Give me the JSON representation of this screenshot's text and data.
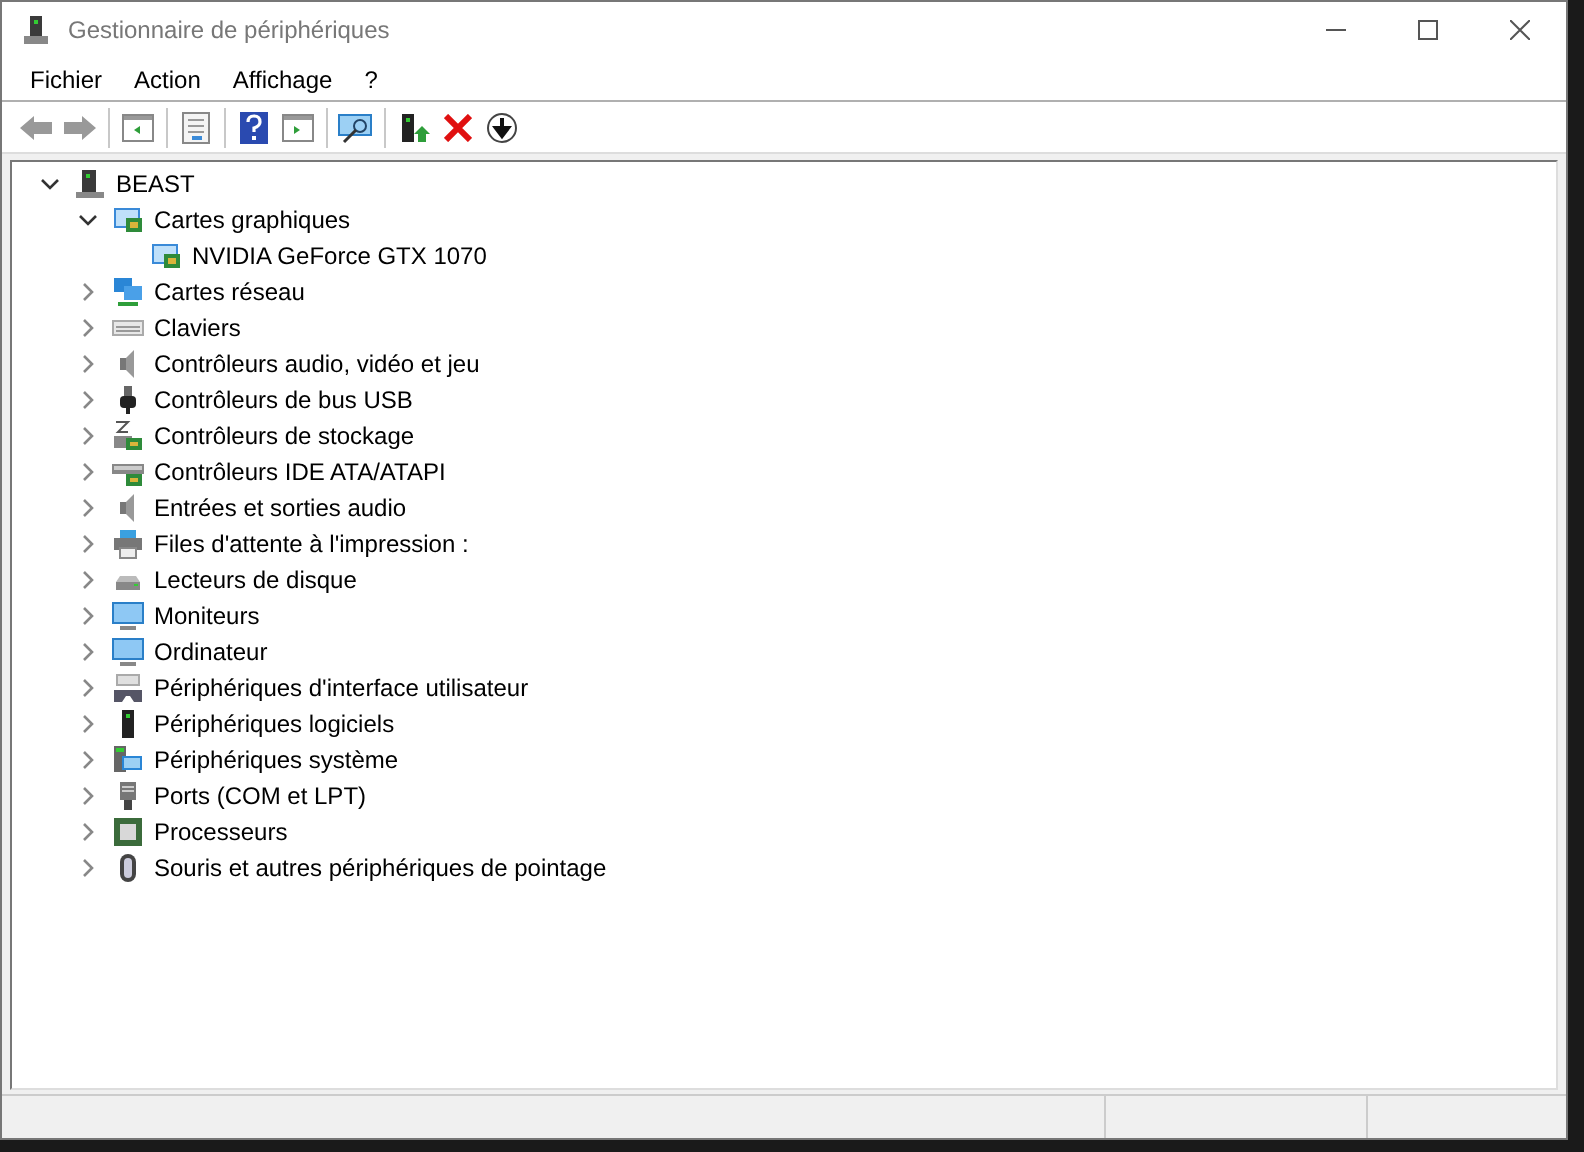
{
  "window": {
    "title": "Gestionnaire de périphériques"
  },
  "menu": [
    "Fichier",
    "Action",
    "Affichage",
    "?"
  ],
  "tree": [
    {
      "label": "BEAST",
      "kind": "computer",
      "expanded": true,
      "children": [
        {
          "label": "Cartes graphiques",
          "kind": "display",
          "expanded": true,
          "children": [
            {
              "label": "NVIDIA GeForce GTX 1070",
              "kind": "display"
            }
          ]
        },
        {
          "label": "Cartes réseau",
          "kind": "network",
          "expanded": false
        },
        {
          "label": "Claviers",
          "kind": "keyboard",
          "expanded": false
        },
        {
          "label": "Contrôleurs audio, vidéo et jeu",
          "kind": "speaker",
          "expanded": false
        },
        {
          "label": "Contrôleurs de bus USB",
          "kind": "usb",
          "expanded": false
        },
        {
          "label": "Contrôleurs de stockage",
          "kind": "storage",
          "expanded": false
        },
        {
          "label": "Contrôleurs IDE ATA/ATAPI",
          "kind": "ide",
          "expanded": false
        },
        {
          "label": "Entrées et sorties audio",
          "kind": "speaker",
          "expanded": false
        },
        {
          "label": "Files d'attente à l'impression :",
          "kind": "printer",
          "expanded": false
        },
        {
          "label": "Lecteurs de disque",
          "kind": "disk",
          "expanded": false
        },
        {
          "label": "Moniteurs",
          "kind": "monitor",
          "expanded": false
        },
        {
          "label": "Ordinateur",
          "kind": "monitor",
          "expanded": false
        },
        {
          "label": "Périphériques d'interface utilisateur",
          "kind": "hid",
          "expanded": false
        },
        {
          "label": "Périphériques logiciels",
          "kind": "software",
          "expanded": false
        },
        {
          "label": "Périphériques système",
          "kind": "system",
          "expanded": false
        },
        {
          "label": "Ports (COM et LPT)",
          "kind": "port",
          "expanded": false
        },
        {
          "label": "Processeurs",
          "kind": "chip",
          "expanded": false
        },
        {
          "label": "Souris et autres périphériques de pointage",
          "kind": "mouse",
          "expanded": false
        }
      ]
    }
  ]
}
